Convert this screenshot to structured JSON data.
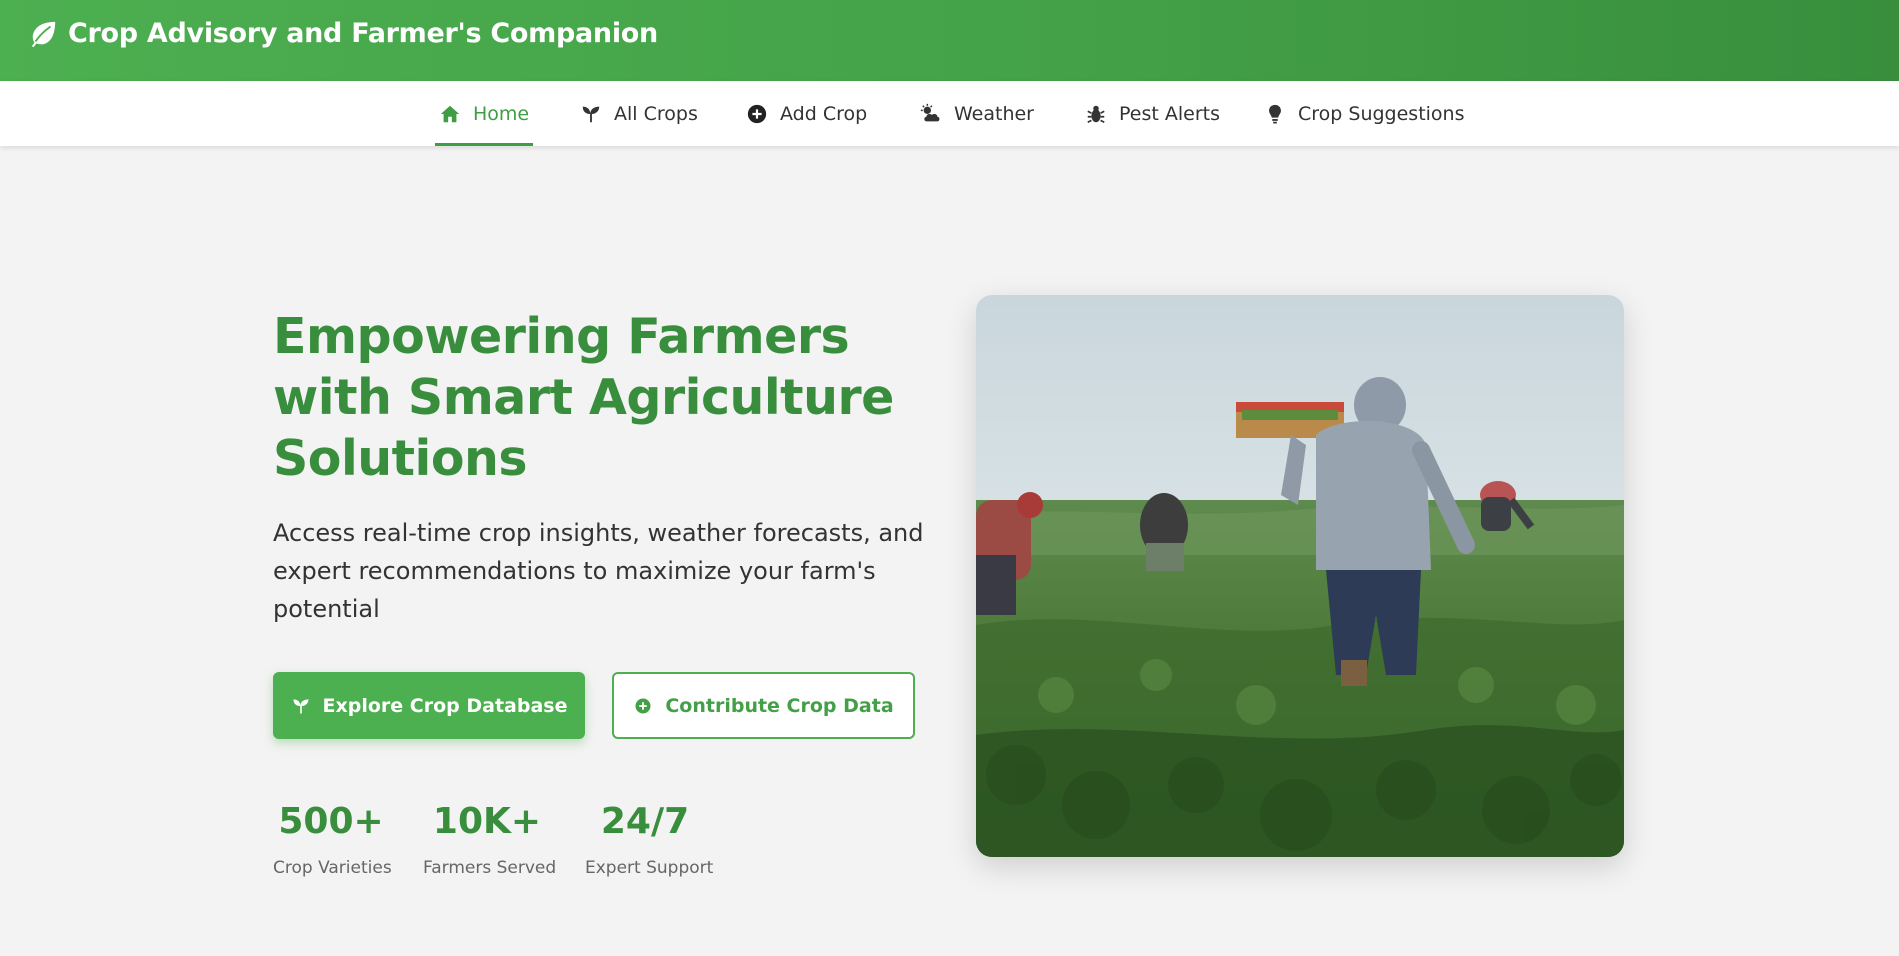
{
  "header": {
    "icon": "leaf-icon",
    "title": "Crop Advisory and Farmer's Companion"
  },
  "nav": {
    "items": [
      {
        "label": "Home",
        "icon": "home-icon",
        "active": true
      },
      {
        "label": "All Crops",
        "icon": "seedling-icon",
        "active": false
      },
      {
        "label": "Add Crop",
        "icon": "plus-circle-icon",
        "active": false
      },
      {
        "label": "Weather",
        "icon": "cloud-sun-icon",
        "active": false
      },
      {
        "label": "Pest Alerts",
        "icon": "bug-icon",
        "active": false
      },
      {
        "label": "Crop Suggestions",
        "icon": "lightbulb-icon",
        "active": false
      }
    ]
  },
  "hero": {
    "title": "Empowering Farmers with Smart Agriculture Solutions",
    "description": "Access real-time crop insights, weather forecasts, and expert recommendations to maximize your farm's potential",
    "primary_button": {
      "label": "Explore Crop Database",
      "icon": "seedling-icon"
    },
    "secondary_button": {
      "label": "Contribute Crop Data",
      "icon": "plus-circle-icon"
    },
    "stats": [
      {
        "value": "500+",
        "label": "Crop Varieties"
      },
      {
        "value": "10K+",
        "label": "Farmers Served"
      },
      {
        "value": "24/7",
        "label": "Expert Support"
      }
    ]
  },
  "colors": {
    "brand_green": "#4caf50",
    "dark_green": "#388e3c",
    "page_bg": "#f3f3f3"
  }
}
